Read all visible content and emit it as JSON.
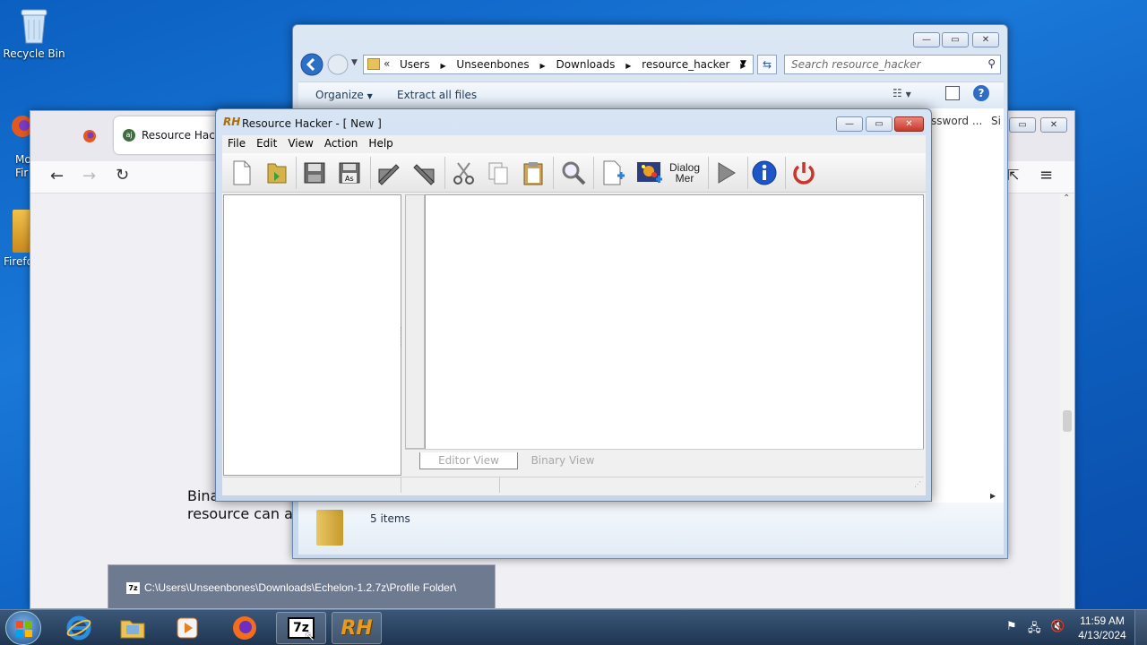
{
  "desktop": {
    "icons": [
      {
        "label": "Recycle Bin"
      },
      {
        "label": "Mo\nFir"
      },
      {
        "label": "Firefo"
      }
    ]
  },
  "firefox": {
    "tab_title": "Resource Hacke",
    "page_text_line1": "Bina",
    "page_text_line2": "resource can a"
  },
  "explorer": {
    "breadcrumb": [
      "Users",
      "Unseenbones",
      "Downloads",
      "resource_hacker"
    ],
    "search_placeholder": "Search resource_hacker",
    "toolbar": {
      "organize": "Organize",
      "extract": "Extract all files"
    },
    "column_header_partial": "ssword ...",
    "column_header_partial2": "Si",
    "status_items": "5 items"
  },
  "rh": {
    "title": "Resource Hacker - [ New ]",
    "menu": [
      "File",
      "Edit",
      "View",
      "Action",
      "Help"
    ],
    "tool_labels": {
      "dialog_line1": "Dialog",
      "dialog_line2": "Mer"
    },
    "tabs": {
      "editor": "Editor View",
      "binary": "Binary View"
    }
  },
  "tooltip": {
    "icon_text": "7z",
    "path": "C:\\Users\\Unseenbones\\Downloads\\Echelon-1.2.7z\\Profile Folder\\"
  },
  "taskbar": {
    "clock_time": "11:59 AM",
    "clock_date": "4/13/2024",
    "rh_label": "RH",
    "sevenzip_label": "7z"
  },
  "colors": {
    "accent": "#1a78d8",
    "taskbar": "#2a4566",
    "rh_close": "#c8372d"
  }
}
